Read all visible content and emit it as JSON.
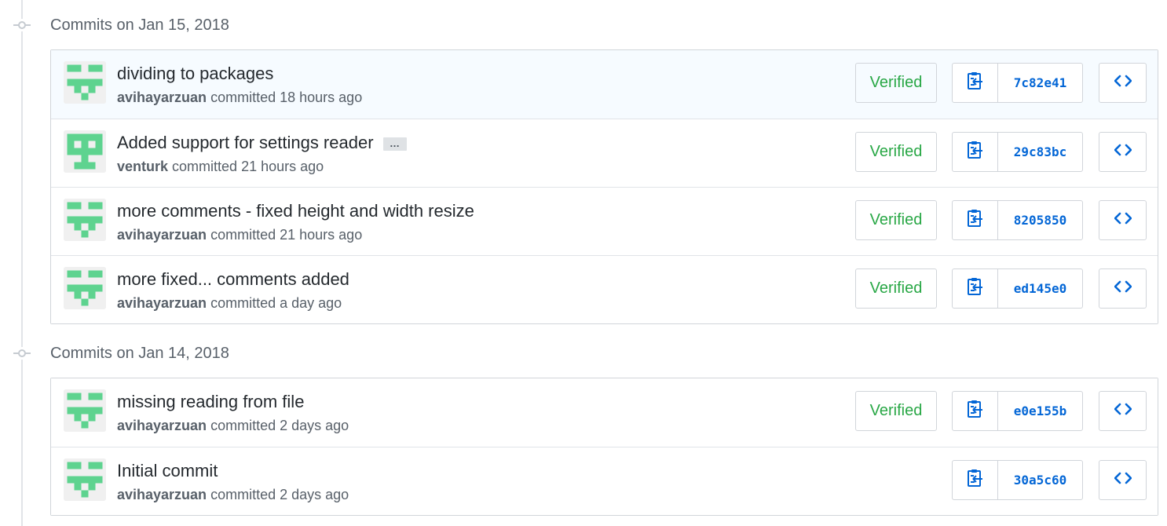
{
  "colors": {
    "verified": "#28a745",
    "link": "#0366d6",
    "avatar_green": "#5ed38f"
  },
  "groups": [
    {
      "title": "Commits on Jan 15, 2018",
      "commits": [
        {
          "message": "dividing to packages",
          "author": "avihayarzuan",
          "verb": "committed",
          "time": "18 hours ago",
          "verified": "Verified",
          "sha": "7c82e41",
          "avatar_icon": "identicon-avatar-a",
          "has_ellipsis": false,
          "highlight": true
        },
        {
          "message": "Added support for settings reader",
          "author": "venturk",
          "verb": "committed",
          "time": "21 hours ago",
          "verified": "Verified",
          "sha": "29c83bc",
          "avatar_icon": "identicon-avatar-b",
          "has_ellipsis": true,
          "ellipsis": "…",
          "highlight": false
        },
        {
          "message": "more comments - fixed height and width resize",
          "author": "avihayarzuan",
          "verb": "committed",
          "time": "21 hours ago",
          "verified": "Verified",
          "sha": "8205850",
          "avatar_icon": "identicon-avatar-a",
          "has_ellipsis": false,
          "highlight": false
        },
        {
          "message": "more fixed... comments added",
          "author": "avihayarzuan",
          "verb": "committed",
          "time": "a day ago",
          "verified": "Verified",
          "sha": "ed145e0",
          "avatar_icon": "identicon-avatar-a",
          "has_ellipsis": false,
          "highlight": false
        }
      ]
    },
    {
      "title": "Commits on Jan 14, 2018",
      "commits": [
        {
          "message": "missing reading from file",
          "author": "avihayarzuan",
          "verb": "committed",
          "time": "2 days ago",
          "verified": "Verified",
          "sha": "e0e155b",
          "avatar_icon": "identicon-avatar-a",
          "has_ellipsis": false,
          "highlight": false
        },
        {
          "message": "Initial commit",
          "author": "avihayarzuan",
          "verb": "committed",
          "time": "2 days ago",
          "verified": "",
          "sha": "30a5c60",
          "avatar_icon": "identicon-avatar-a",
          "has_ellipsis": false,
          "highlight": false
        }
      ]
    }
  ],
  "icons": {
    "copy": "clippy-icon",
    "browse": "code-icon",
    "timeline": "git-commit-icon"
  }
}
